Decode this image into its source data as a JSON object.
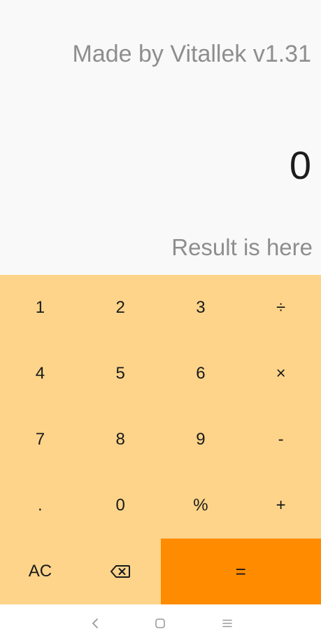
{
  "display": {
    "credit": "Made by Vitallek v1.31",
    "expression": "0",
    "result_placeholder": "Result is here"
  },
  "keypad": {
    "rows": [
      [
        "1",
        "2",
        "3",
        "÷"
      ],
      [
        "4",
        "5",
        "6",
        "×"
      ],
      [
        "7",
        "8",
        "9",
        "-"
      ],
      [
        ".",
        "0",
        "%",
        "+"
      ]
    ],
    "clear_label": "AC",
    "backspace_icon": "backspace-icon",
    "equals_label": "="
  },
  "navbar": {
    "back_icon": "back-icon",
    "home_icon": "home-icon",
    "menu_icon": "menu-icon"
  },
  "colors": {
    "keypad_bg": "#fdd48a",
    "equals_bg": "#fe8b00",
    "display_bg": "#f9f9f9",
    "muted_text": "#8e8e8e"
  }
}
